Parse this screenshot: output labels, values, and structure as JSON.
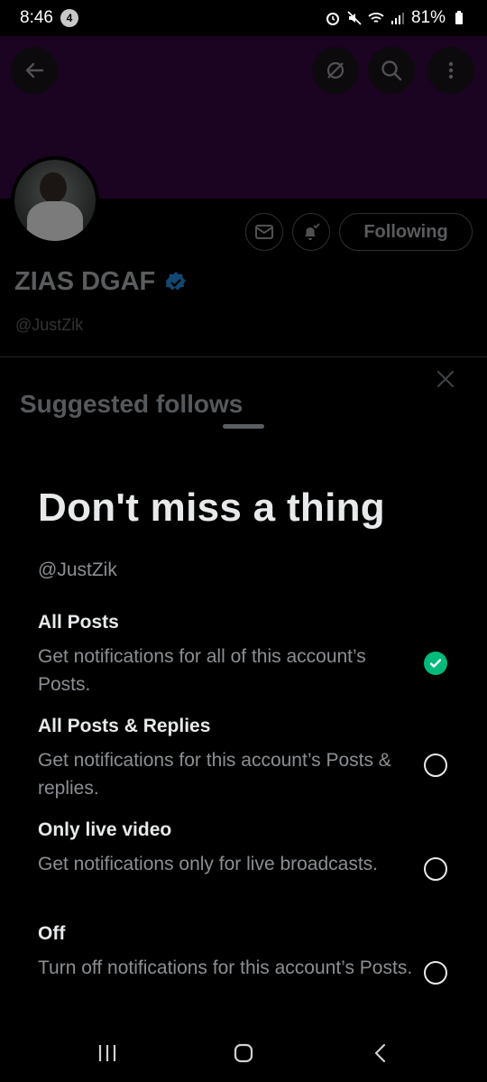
{
  "status_bar": {
    "time": "8:46",
    "notification_count": "4",
    "battery_percent": "81%"
  },
  "profile": {
    "name": "ZIAS DGAF",
    "handle": "@JustZik",
    "following_label": "Following",
    "verified": true,
    "banner_color": "#2a0535"
  },
  "sheet": {
    "tab_label": "Suggested follows",
    "title": "Don't miss a thing",
    "handle": "@JustZik",
    "options": [
      {
        "title": "All Posts",
        "description": "Get notifications for all of this account’s Posts.",
        "selected": true
      },
      {
        "title": "All Posts & Replies",
        "description": "Get notifications for this account’s Posts & replies.",
        "selected": false
      },
      {
        "title": "Only live video",
        "description": "Get notifications only for live broadcasts.",
        "selected": false
      },
      {
        "title": "Off",
        "description": "Turn off notifications for this account’s Posts.",
        "selected": false
      }
    ]
  },
  "colors": {
    "accent_green": "#00ba7c",
    "verified_blue": "#1d9bf0"
  },
  "icons": {
    "back": "arrow-left-icon",
    "grok": "grok-icon",
    "search": "search-icon",
    "more": "more-vertical-icon",
    "message": "envelope-icon",
    "notify": "bell-check-icon",
    "close": "close-icon"
  }
}
